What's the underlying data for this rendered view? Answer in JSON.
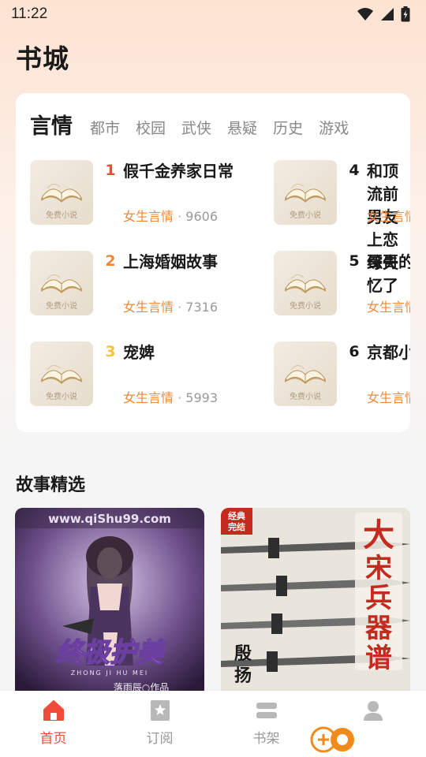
{
  "status_bar": {
    "time": "11:22"
  },
  "page": {
    "title": "书城"
  },
  "rank": {
    "tabs": [
      {
        "label": "言情",
        "active": true
      },
      {
        "label": "都市",
        "active": false
      },
      {
        "label": "校园",
        "active": false
      },
      {
        "label": "武侠",
        "active": false
      },
      {
        "label": "悬疑",
        "active": false
      },
      {
        "label": "历史",
        "active": false
      },
      {
        "label": "游戏",
        "active": false
      }
    ],
    "books": [
      {
        "rank": "1",
        "title": "假千金养家日常",
        "genre": "女生言情",
        "separator": "·",
        "count": "9606",
        "rank_color": "#f04b3a"
      },
      {
        "rank": "2",
        "title": "上海婚姻故事",
        "genre": "女生言情",
        "separator": "·",
        "count": "7316",
        "rank_color": "#f0883a"
      },
      {
        "rank": "3",
        "title": "宠婢",
        "genre": "女生言情",
        "separator": "·",
        "count": "5993",
        "rank_color": "#f5c242"
      },
      {
        "rank": "4",
        "title": "和顶流前男友上恋综失忆了",
        "genre": "女生言情",
        "separator": "",
        "count": "",
        "rank_color": "#1a1a1a"
      },
      {
        "rank": "5",
        "title": "哥哥的",
        "genre": "女生言情",
        "separator": "",
        "count": "",
        "rank_color": "#1a1a1a"
      },
      {
        "rank": "6",
        "title": "京都小",
        "genre": "女生言情",
        "separator": "",
        "count": "",
        "rank_color": "#1a1a1a"
      }
    ],
    "cover_caption": "免费小说"
  },
  "stories": {
    "title": "故事精选",
    "cards": [
      {
        "watermark": "www.qiShu99.com",
        "cover_title": "终极护美",
        "pinyin": "ZHONG JI HU MEI",
        "author": "落雨辰○作品"
      },
      {
        "badge_line1": "经典",
        "badge_line2": "完结",
        "cover_title_chars": [
          "大",
          "宋",
          "兵",
          "器",
          "谱"
        ],
        "author_chars": [
          "殷",
          "扬"
        ]
      }
    ]
  },
  "bottom_nav": [
    {
      "label": "首页",
      "icon": "home-icon",
      "active": true
    },
    {
      "label": "订阅",
      "icon": "bookmark-icon",
      "active": false
    },
    {
      "label": "书架",
      "icon": "bookshelf-icon",
      "active": false
    },
    {
      "label": "",
      "icon": "user-icon",
      "active": false
    }
  ],
  "watermark": {
    "text": "",
    "sub": ""
  },
  "colors": {
    "accent": "#f04b3a",
    "genre": "#f0883a"
  }
}
